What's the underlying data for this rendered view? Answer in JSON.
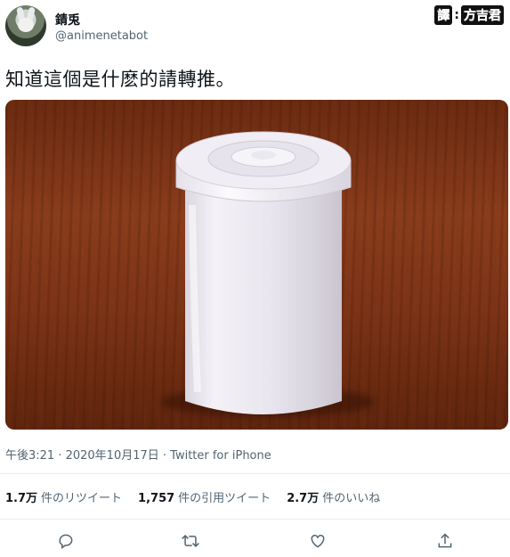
{
  "user": {
    "display_name": "錆兎",
    "handle": "@animenetabot",
    "avatar_icon": "character-avatar-icon"
  },
  "credit": {
    "prefix": "譯",
    "separator": ":",
    "name": "方吉君"
  },
  "tweet": {
    "text": "知道這個是什麽的請轉推。",
    "image_subject": "film-canister-photo",
    "timestamp": "午後3:21 · 2020年10月17日 · Twitter for iPhone"
  },
  "stats": [
    {
      "value": "1.7万",
      "label": "件のリツイート"
    },
    {
      "value": "1,757",
      "label": "件の引用ツイート"
    },
    {
      "value": "2.7万",
      "label": "件のいいね"
    }
  ],
  "actions": [
    {
      "icon": "reply-icon"
    },
    {
      "icon": "retweet-icon"
    },
    {
      "icon": "like-icon"
    },
    {
      "icon": "share-icon"
    }
  ],
  "colors": {
    "text_primary": "#0f1419",
    "text_secondary": "#536471",
    "divider": "#e6ecf0"
  }
}
